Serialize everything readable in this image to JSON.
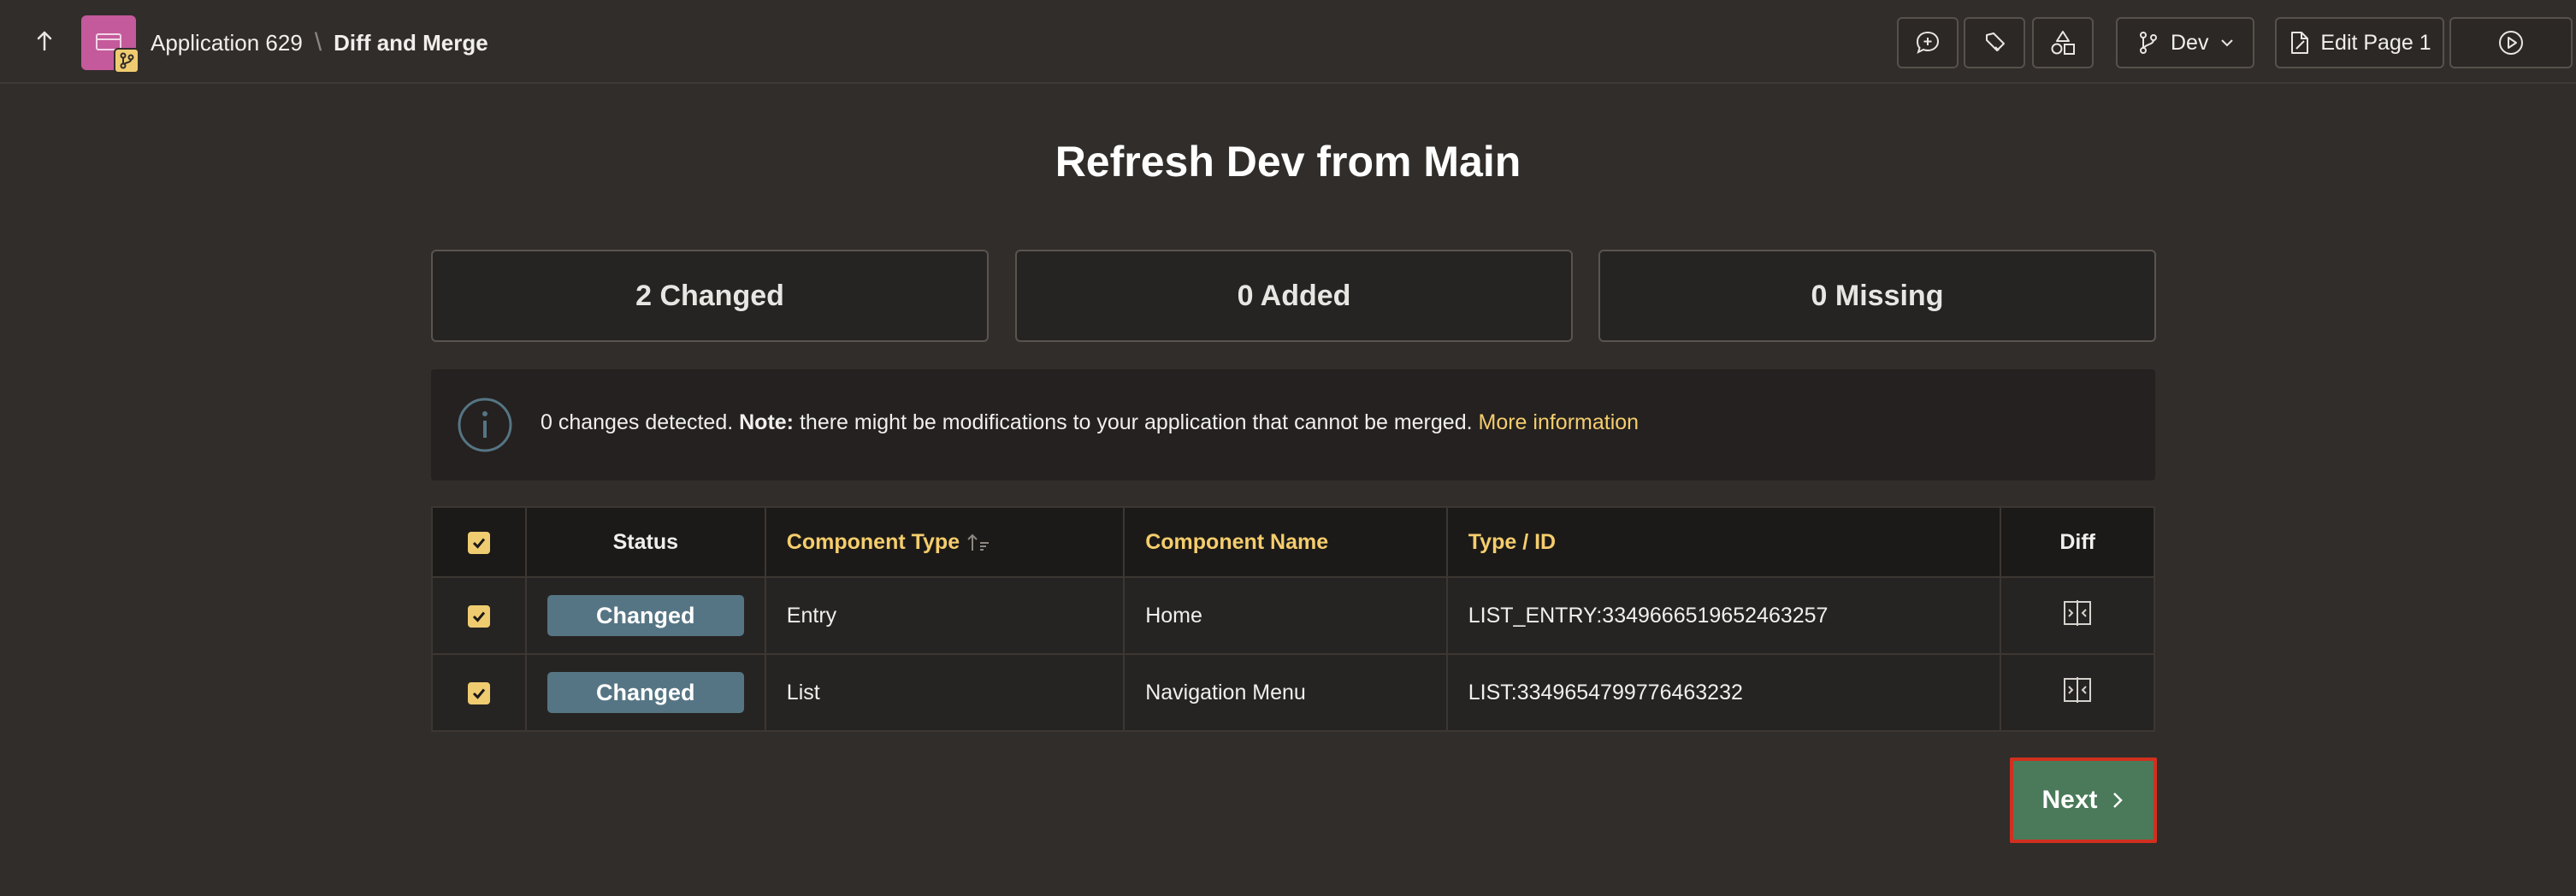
{
  "header": {
    "app_name": "Application 629",
    "separator": "\\",
    "page_name": "Diff and Merge",
    "branch_label": "Dev",
    "edit_page_label": "Edit Page 1"
  },
  "main": {
    "title": "Refresh Dev from Main",
    "stats": {
      "changed": "2 Changed",
      "added": "0 Added",
      "missing": "0 Missing"
    },
    "info": {
      "text1": "0 changes detected.",
      "note_label": "Note:",
      "text2": "there might be modifications to your application that cannot be merged.",
      "link": "More information"
    },
    "table": {
      "headers": {
        "status": "Status",
        "component_type": "Component Type",
        "component_name": "Component Name",
        "type_id": "Type / ID",
        "diff": "Diff"
      },
      "rows": [
        {
          "status": "Changed",
          "type": "Entry",
          "name": "Home",
          "id": "LIST_ENTRY:3349666519652463257",
          "checked": true
        },
        {
          "status": "Changed",
          "type": "List",
          "name": "Navigation Menu",
          "id": "LIST:3349654799776463232",
          "checked": true
        }
      ]
    },
    "next_label": "Next"
  },
  "colors": {
    "accent": "#f5cd6d",
    "status_pill": "#567584",
    "next_button": "#4a7a59",
    "next_outline": "#d1301f"
  }
}
